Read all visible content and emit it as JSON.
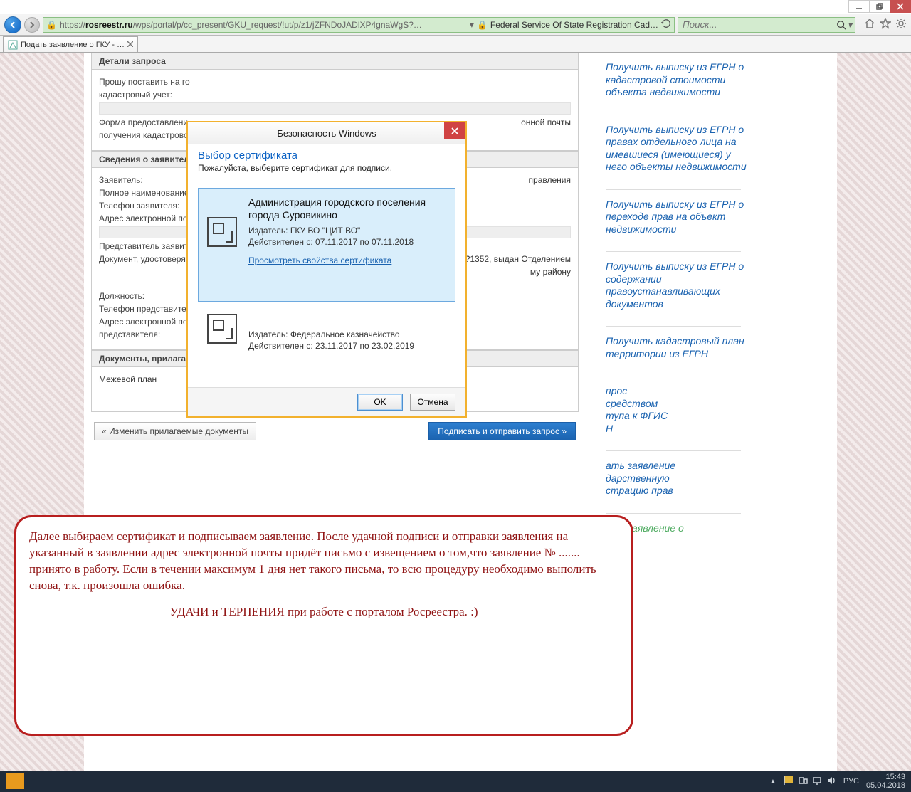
{
  "window_controls": {
    "minimize": "—",
    "maximize": "❐",
    "close": "✕"
  },
  "address_bar": {
    "domain": "rosreestr.ru",
    "path": "/wps/portal/p/cc_present/GKU_request/!ut/p/z1/jZFNDoJADlXP4gnaWgS?…",
    "prefix": "https://",
    "site_title": "Federal Service Of State Registration Cad…"
  },
  "search": {
    "placeholder": "Поиск..."
  },
  "tab": {
    "title": "Подать заявление о ГКУ - …"
  },
  "form": {
    "section1_title": "Детали запроса",
    "s1_line1": "Прошу поставить на го",
    "s1_line1b": "кадастровый учет:",
    "s1_line2": "Форма предоставлени",
    "s1_line2b": "получения кадастрово",
    "s1_right": "онной почты",
    "section2_title": "Сведения о заявителе",
    "l_applicant": "Заявитель:",
    "v_applicant": "правления",
    "l_fullname": "Полное наименование",
    "l_phone": "Телефон заявителя:",
    "l_email": "Адрес электронной по",
    "l_rep": "Представитель заявит",
    "l_doc": "Документ, удостоверя",
    "v_doc": "?1352, выдан Отделением",
    "v_doc2": "му району",
    "l_post": "Должность:",
    "l_repphone": "Телефон представител",
    "l_repemail": "Адрес электронной по",
    "l_repemail2": "представителя:",
    "section3_title": "Документы, прилагаемые",
    "s3_item": "Межевой план",
    "btn_back": "« Изменить прилагаемые документы",
    "btn_submit": "Подписать и отправить запрос »"
  },
  "sidebar": {
    "links": [
      "Получить выписку из ЕГРН о кадастровой стоимости объекта недвижимости",
      "Получить выписку из ЕГРН о правах отдельного лица на имевшиеся (имеющиеся) у него объекты недвижимости",
      "Получить выписку из ЕГРН о переходе прав на объект недвижимости",
      "Получить выписку из ЕГРН о содержании правоустанавливающих документов",
      "Получить кадастровый план территории из ЕГРН",
      "Запрос посредством доступа к ФГИС ЕГРН",
      "Подать заявление на государственную регистрацию прав",
      "Подать заявление о ГКУ"
    ],
    "fragments": {
      "5a": "прос",
      "5b": "средством",
      "5c": "тупа к ФГИС",
      "5d": "Н",
      "6a": "ать заявление",
      "6b": "дарственную",
      "6c": "страцию прав",
      "7": "ать заявление о"
    }
  },
  "popup": {
    "title": "Безопасность Windows",
    "h": "Выбор сертификата",
    "sub": "Пожалуйста, выберите сертификат для подписи.",
    "cert1_title": "Администрация городского поселения города Суровикино",
    "cert1_issuer": "Издатель: ГКУ ВО \"ЦИТ ВО\"",
    "cert1_valid": "Действителен с: 07.11.2017 по 07.11.2018",
    "cert_link": "Просмотреть свойства сертификата",
    "cert2_issuer": "Издатель: Федеральное казначейство",
    "cert2_valid": "Действителен с: 23.11.2017 по 23.02.2019",
    "ok": "OK",
    "cancel": "Отмена"
  },
  "annotation": {
    "p1": "Далее выбираем сертификат и подписываем заявление.  После удачной подписи и отправки заявления на указанный в заявлении адрес электронной почты  придёт  письмо с извещением о том,что заявление № .......  принято в работу. Если в течении максимум 1 дня нет такого письма, то всю процедуру необходимо выполить снова, т.к. произошла ошибка.",
    "p2": "УДАЧИ и ТЕРПЕНИЯ при работе с порталом Росреестра. :)"
  },
  "taskbar": {
    "lang": "РУС",
    "time": "15:43",
    "date": "05.04.2018"
  }
}
